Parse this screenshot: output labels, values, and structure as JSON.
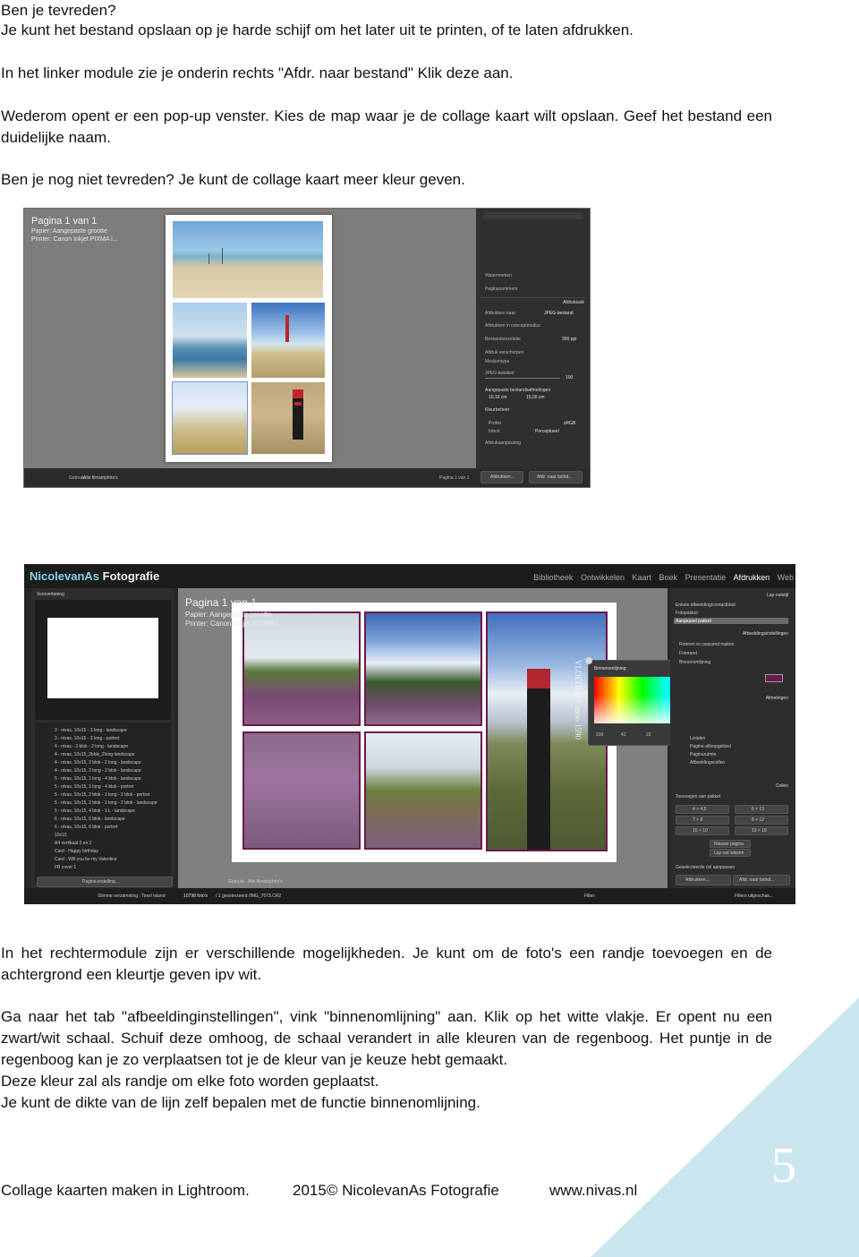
{
  "intro": {
    "line1": "Ben je tevreden?",
    "line2": "Je kunt het bestand opslaan op je harde schijf om het later uit te printen, of te laten afdrukken.",
    "line3": "In het linker module zie je onderin rechts \"Afdr. naar bestand\" Klik deze aan.",
    "para_save": "Wederom opent er een pop-up venster.  Kies de map waar je de collage kaart wilt opslaan.  Geef het bestand een duidelijke naam.",
    "line_color": "Ben je nog niet tevreden?  Je kunt de collage kaart  meer kleur geven."
  },
  "screenshot1": {
    "overlay_title": "Pagina 1 van 1",
    "overlay_paper": "Papier: Aangepaste grootte",
    "overlay_printer": "Printer: Canon Inkjet PIXMA i...",
    "panel": {
      "watermark": "Watermerken",
      "page_numbering": "Paginanummers",
      "print_job": "Afdruktaak",
      "print_to": "Afdrukken naar:",
      "print_to_value": "JPEG-bestand",
      "draft_mode": "Afdrukken in conceptmodus",
      "file_resolution": "Bestandsresolutie",
      "resolution_value": "300 ppi",
      "sharpen": "Afdruk verscherpen",
      "media_type": "Mediumtype",
      "jpeg_quality": "JPEG-kwaliteit",
      "quality_value": "100",
      "custom_size": "Aangepaste bestandsafmetingen",
      "width_value": "10,16 cm",
      "height_value": "15,00 cm",
      "color_mgmt": "Kleurbeheer",
      "profile": "Profiel",
      "profile_value": "sRGB",
      "intent": "Intent",
      "intent_value": "Perceptueel",
      "adjust": "Afdrukaanpassing"
    },
    "bottom_use": "Gebruik:",
    "bottom_use_value": "Alle filmstripfoto's",
    "bottom_page": "Pagina 1 van 1",
    "btn_print": "Afdrukken...",
    "btn_print_file": "Afdr. naar bstnd..."
  },
  "screenshot2": {
    "brand_name": "NicolevanAs",
    "brand_suffix": "Fotografie",
    "modules": [
      "Bibliotheek",
      "Ontwikkelen",
      "Kaart",
      "Boek",
      "Presentatie",
      "Afdrukken",
      "Web"
    ],
    "preview_label": "Voorvertoning",
    "templates": [
      "3 - nivas, 10x15 - 3 long - landscape",
      "3 - nivas, 10x15 - 3 long - portret",
      "4 - nivas - 2 blok - 2 long - landscape",
      "4 - nivas, 10x15_2blok_2long-landscape",
      "4 - nivas, 10x15, 2 blok - 2 long - landscape",
      "4 - nivas, 10x15, 2 long - 2 blok - landscape",
      "5 - nivas, 10x15, 1 long - 4 blok - landscape",
      "5 - nivas, 10x15, 1 long - 4 blok - portret",
      "5 - nivas, 10x15, 2 blok - 1 long - 2 blok - portret",
      "5 - nivas, 10x15, 2 blok - 1 long - 2 blok - landscape",
      "5 - nivas, 10x15, 4 blok - 1 L - landscape",
      "6 - nivas, 10x15, 6 blok - landscape",
      "6 - nivas, 10x15, 6 blok - portret",
      "10x15",
      "A4 vertikaal 3 en 2",
      "Card - Happy birthday",
      "Card - Will you be my Valentine",
      "FB cover 1"
    ],
    "page_setup_button": "Pagina-instelling...",
    "overlay_title": "Pagina 1 van 1",
    "overlay_paper": "Papier: Aangepaste grootte",
    "overlay_printer": "Printer: Canon Inkjet PIXMA i...",
    "post_text": "VLOEDLIJN anno 1590",
    "picker_label": "Binnenomlijning:",
    "picker_values": [
      "316",
      "41",
      "22",
      "40",
      "4",
      "30"
    ],
    "right_panel": {
      "layout_style": "Lay-outstijl",
      "single_image": "Enkele afbeelding/contactblad",
      "picture_package": "Fotopakket",
      "custom_package": "Aangepast pakket",
      "image_settings": "Afbeeldingsinstellingen",
      "rotate_fit": "Roteren en passend maken",
      "photo_border": "Fotorand",
      "inner_stroke": "Binnenomlijning",
      "rulers": "Linialen",
      "page_grid": "Pagina-afloopgebied",
      "page_guides": "Paginaruimte",
      "image_cells": "Afbeeldingscellen",
      "dimensions": "Afmetingen",
      "cells": "Cellen",
      "add_to_package": "Toevoegen aan pakket",
      "cell_buttons": [
        "4 × 4,5",
        "6 × 13",
        "7 × 9",
        "8 × 12",
        "15 × 10",
        "13 × 18"
      ],
      "new_page": "Nieuwe pagina",
      "clear_layout": "Lay-out wissen",
      "auto_layout": "Geselecteerde cel aanpassen",
      "btn_print": "Afdrukken...",
      "btn_print_file": "Afdr. naar bstnd..."
    },
    "bottom_use": "Gebruik:",
    "bottom_use_value": "Alle filmstripfoto's",
    "status_collection": "Slimme verzameling : Texel Island",
    "status_photos": "10798 foto's",
    "status_selected": "/ 1 geselecteerd /IMG_7673.CR2",
    "filter_label": "Filter:",
    "filter_value": "Filters uitgeschak..."
  },
  "body": {
    "para_right_module": "In het rechtermodule zijn er verschillende mogelijkheden.  Je kunt om de foto's een randje toevoegen en de achtergrond een kleurtje geven ipv wit.",
    "para_tab": "Ga naar het tab \"afbeeldinginstellingen\", vink \"binnenomlijning\" aan. Klik op het witte vlakje. Er opent nu een zwart/wit schaal. Schuif deze omhoog, de schaal verandert  in alle kleuren van de regenboog.  Het puntje in de regenboog kan je zo verplaatsen tot je de kleur van je keuze hebt gemaakt.",
    "line_border": "Deze kleur zal als randje om elke foto worden geplaatst.",
    "line_thickness": "Je kunt de dikte van de lijn zelf bepalen met de functie binnenomlijning."
  },
  "footer": {
    "title": "Collage kaarten maken in Lightroom.",
    "copyright": "2015© NicolevanAs  Fotografie",
    "website": "www.nivas.nl",
    "page_number": "5"
  },
  "colors": {
    "corner": "#c9e6ef",
    "stroke": "#6b1a4b",
    "brand_accent": "#7fd4ea"
  }
}
